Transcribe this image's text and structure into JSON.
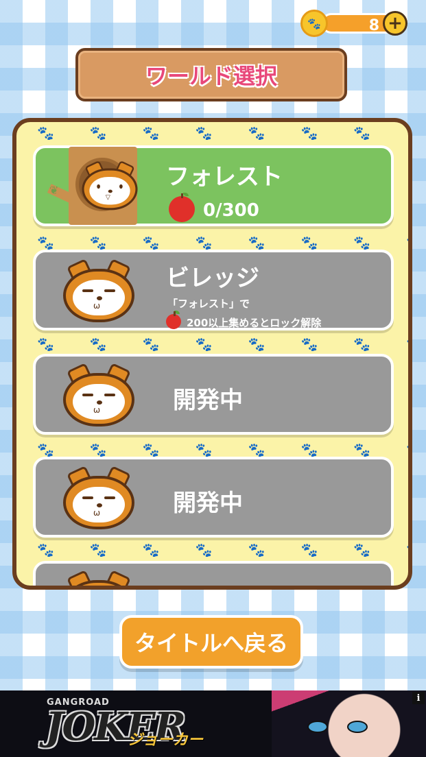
{
  "header": {
    "coin_icon": "paw-coin-icon",
    "coin_count": "8",
    "add_coins": "+"
  },
  "title": "ワールド選択",
  "worlds": [
    {
      "name": "フォレスト",
      "apples": "0/300",
      "state": "unlocked",
      "color": "#7cc35f"
    },
    {
      "name": "ビレッジ",
      "lock_line1": "「フォレスト」で",
      "lock_line2": "200以上集めるとロック解除",
      "state": "locked",
      "color": "#999999"
    },
    {
      "name": "開発中",
      "state": "locked"
    },
    {
      "name": "開発中",
      "state": "locked"
    },
    {
      "name": "",
      "state": "locked"
    }
  ],
  "back_button": "タイトルへ戻る",
  "ad": {
    "small_text": "GANGROAD",
    "big_text": "JOKER",
    "kana": "ジョーカー",
    "info": "i"
  }
}
